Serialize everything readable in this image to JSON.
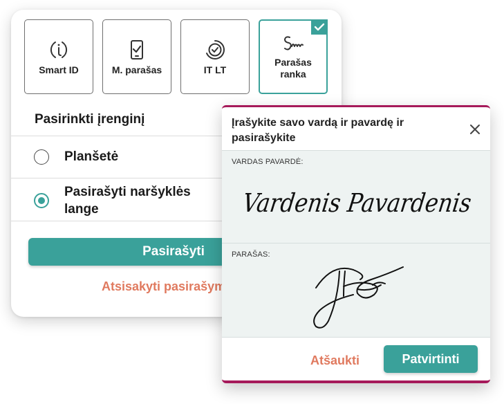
{
  "colors": {
    "accent": "#3aa19a",
    "secondary_action": "#e07a5f",
    "modal_border": "#a61a5a"
  },
  "methods": [
    {
      "label": "Smart ID",
      "icon": "smart-id-icon"
    },
    {
      "label": "M. parašas",
      "icon": "mobile-signature-icon"
    },
    {
      "label": "IT LT",
      "icon": "it-lt-icon"
    },
    {
      "label": "Parašas ranka",
      "icon": "handwritten-signature-icon",
      "selected": true
    }
  ],
  "device": {
    "title": "Pasirinkti įrenginį",
    "options": [
      {
        "label": "Planšetė",
        "selected": false
      },
      {
        "label": "Pasirašyti naršyklės lange",
        "selected": true
      }
    ]
  },
  "actions": {
    "sign_label": "Pasirašyti",
    "cancel_label": "Atsisakyti pasirašymo"
  },
  "modal": {
    "title": "Įrašykite savo vardą ir pavardę ir pasirašykite",
    "name_field_label": "VARDAS PAVARDĖ:",
    "name_value": "Vardenis Pavardenis",
    "signature_field_label": "PARAŠAS:",
    "cancel_label": "Atšaukti",
    "confirm_label": "Patvirtinti"
  }
}
